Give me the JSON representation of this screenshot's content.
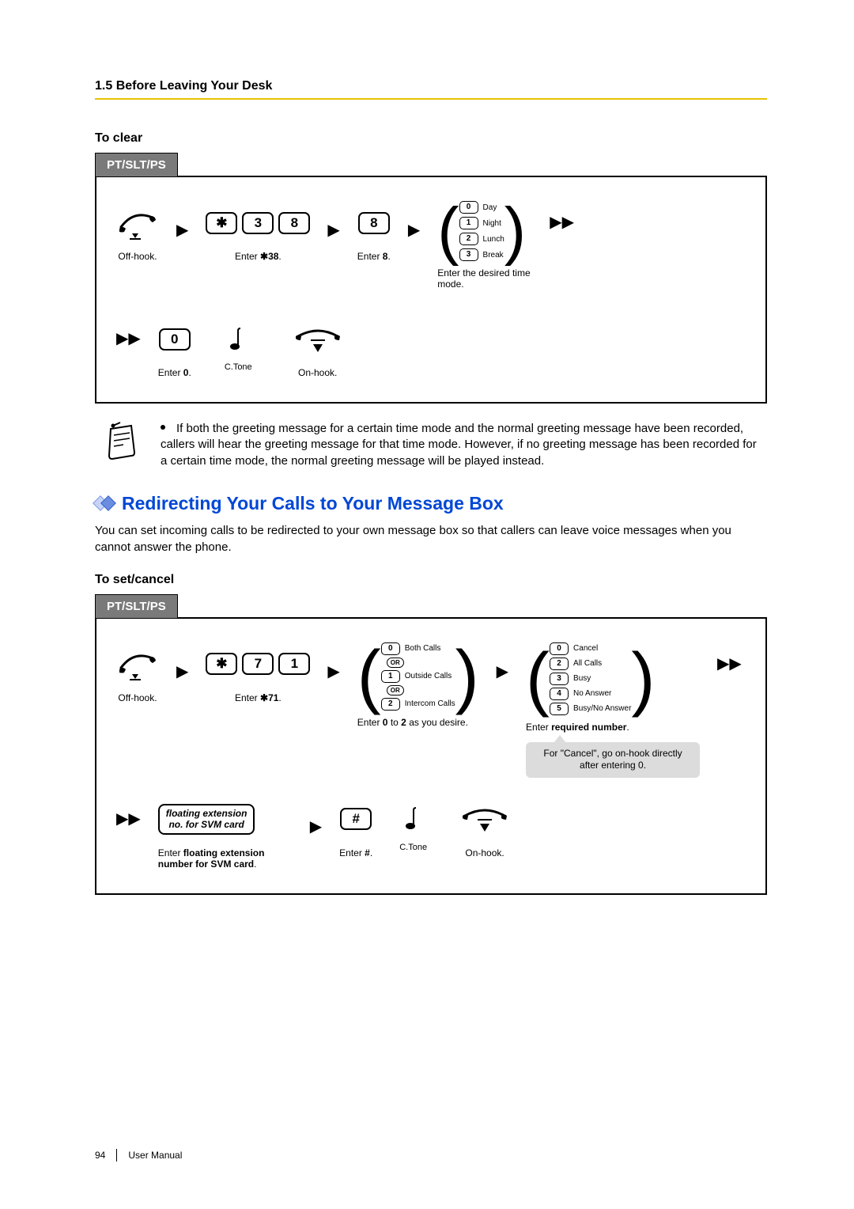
{
  "header": {
    "section_number": "1.5 Before Leaving Your Desk"
  },
  "clear": {
    "heading": "To clear",
    "tab": "PT/SLT/PS",
    "offhook_caption": "Off-hook.",
    "key_star": "✱",
    "key_3": "3",
    "key_8": "8",
    "enter38_caption_before": "Enter ",
    "enter38_code": "✱38",
    "enter38_caption_after": ".",
    "key_8b": "8",
    "enter8_caption_before": "Enter ",
    "enter8_code": "8",
    "enter8_caption_after": ".",
    "time_mode": {
      "caption": "Enter the desired time mode.",
      "items": [
        {
          "key": "0",
          "label": "Day"
        },
        {
          "key": "1",
          "label": "Night"
        },
        {
          "key": "2",
          "label": "Lunch"
        },
        {
          "key": "3",
          "label": "Break"
        }
      ]
    },
    "key_0": "0",
    "enter0_caption_before": "Enter ",
    "enter0_code": "0",
    "enter0_caption_after": ".",
    "ctone_label": "C.Tone",
    "onhook_caption": "On-hook."
  },
  "note": {
    "text": "If both the greeting message for a certain time mode and the normal greeting message have been recorded, callers will hear the greeting message for that time mode. However, if no greeting message has been recorded for a certain time mode, the normal greeting message will be played instead."
  },
  "redirect": {
    "title": "Redirecting Your Calls to Your Message Box",
    "intro": "You can set incoming calls to be redirected to your own message box so that callers can leave voice messages when you cannot answer the phone."
  },
  "setcancel": {
    "heading": "To set/cancel",
    "tab": "PT/SLT/PS",
    "offhook_caption": "Off-hook.",
    "key_star": "✱",
    "key_7": "7",
    "key_1": "1",
    "enter71_caption_before": "Enter ",
    "enter71_code": "✱71",
    "enter71_caption_after": ".",
    "call_types": {
      "caption_before": "Enter ",
      "caption_mid1": "0",
      "caption_mid2": " to ",
      "caption_mid3": "2",
      "caption_after": " as you desire.",
      "items": [
        {
          "key": "0",
          "label": "Both Calls"
        },
        {
          "or": "OR"
        },
        {
          "key": "1",
          "label": "Outside Calls"
        },
        {
          "or": "OR"
        },
        {
          "key": "2",
          "label": "Intercom Calls"
        }
      ]
    },
    "required_number": {
      "caption_before": "Enter ",
      "caption_bold": "required number",
      "caption_after": ".",
      "items": [
        {
          "key": "0",
          "label": "Cancel"
        },
        {
          "key": "2",
          "label": "All Calls"
        },
        {
          "key": "3",
          "label": "Busy"
        },
        {
          "key": "4",
          "label": "No Answer"
        },
        {
          "key": "5",
          "label": "Busy/No Answer"
        }
      ],
      "callout": "For \"Cancel\", go on-hook directly after entering 0."
    },
    "row2": {
      "float_label_line1": "floating extension",
      "float_label_line2": "no. for SVM card",
      "float_caption_before": "Enter ",
      "float_caption_bold": "floating extension number for SVM card",
      "float_caption_after": ".",
      "key_hash": "#",
      "enterhash_caption_before": "Enter ",
      "enterhash_code": "#",
      "enterhash_caption_after": ".",
      "ctone_label": "C.Tone",
      "onhook_caption": "On-hook."
    }
  },
  "footer": {
    "page_no": "94",
    "manual": "User Manual"
  }
}
